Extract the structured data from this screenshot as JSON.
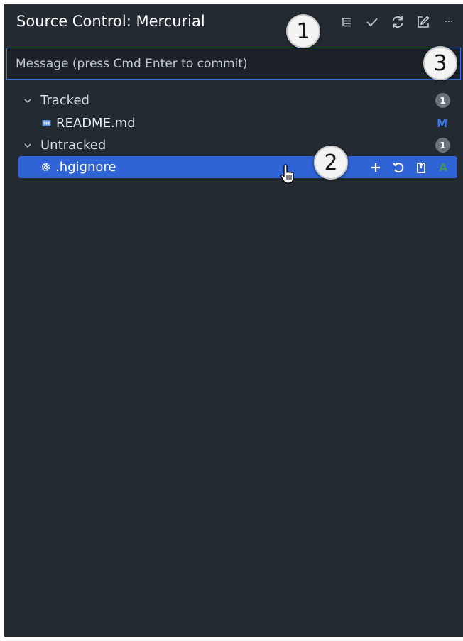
{
  "header": {
    "title": "Source Control: Mercurial",
    "actions": [
      {
        "icon": "view-as-tree-icon"
      },
      {
        "icon": "commit-check-icon"
      },
      {
        "icon": "refresh-icon"
      },
      {
        "icon": "edit-icon"
      },
      {
        "icon": "more-icon",
        "text": "···"
      }
    ]
  },
  "commit": {
    "placeholder": "Message (press Cmd Enter to commit)",
    "value": ""
  },
  "groups": [
    {
      "label": "Tracked",
      "count": "1",
      "files": [
        {
          "name": "README.md",
          "status": "M",
          "status_color": "#3b78e7",
          "icon": "markdown-file-icon"
        }
      ]
    },
    {
      "label": "Untracked",
      "count": "1",
      "files": [
        {
          "name": ".hgignore",
          "status": "A",
          "status_color": "#3e9a4a",
          "icon": "settings-file-icon"
        }
      ]
    }
  ],
  "row_actions": [
    "stage-add-icon",
    "discard-changes-icon",
    "open-file-icon"
  ],
  "callouts": [
    "1",
    "2",
    "3"
  ],
  "colors": {
    "background": "#232a31",
    "selection": "#2f63d6",
    "input_border": "#3a6fd8",
    "modified": "#3b78e7",
    "added": "#3e9a4a"
  }
}
